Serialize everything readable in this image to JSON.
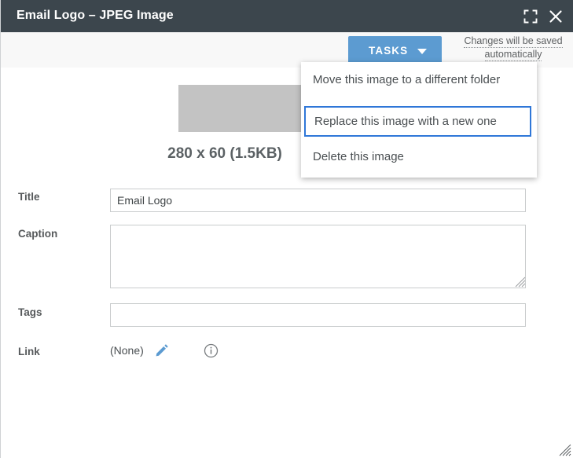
{
  "window": {
    "title": "Email Logo – JPEG Image",
    "expand_icon": "fullscreen-icon",
    "close_icon": "close-icon"
  },
  "toolbar": {
    "tasks_label": "TASKS",
    "tasks_caret_icon": "chevron-down-icon",
    "autosave_note": "Changes will be saved automatically"
  },
  "tasks_menu": {
    "items": [
      {
        "label": "Move this image to a different folder",
        "focused": false
      },
      {
        "label": "Replace this image with a new one",
        "focused": true
      },
      {
        "label": "Delete this image",
        "focused": false
      }
    ]
  },
  "preview": {
    "dimensions_text": "280 x 60 (1.5KB)",
    "placeholder_color": "#c3c3c3"
  },
  "form": {
    "title": {
      "label": "Title",
      "value": "Email Logo",
      "placeholder": ""
    },
    "caption": {
      "label": "Caption",
      "value": "",
      "placeholder": ""
    },
    "tags": {
      "label": "Tags",
      "value": "",
      "placeholder": ""
    },
    "link": {
      "label": "Link",
      "value": "(None)",
      "edit_icon": "pencil-icon",
      "info_icon": "info-circle-icon"
    }
  },
  "colors": {
    "titlebar": "#3c464d",
    "accent_blue": "#5c9bd1",
    "focus_blue": "#2f77d8",
    "icon_blue": "#5c9bd1",
    "toolbar_bg": "#f8f8f8"
  }
}
